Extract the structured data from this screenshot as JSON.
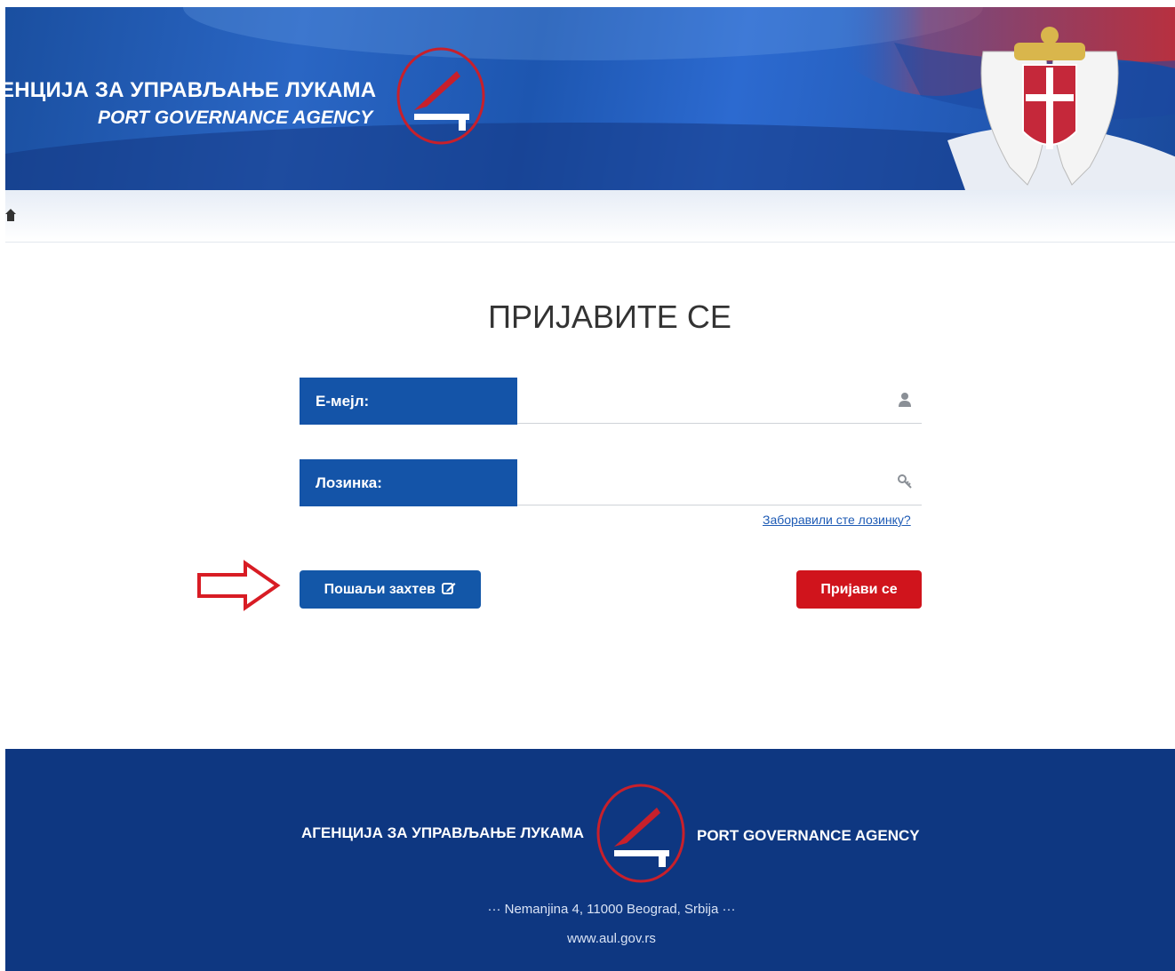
{
  "header": {
    "agency_name_sr": "ЕНЦИЈА ЗА УПРАВЉАЊЕ ЛУКАМА",
    "agency_name_en": "PORT GOVERNANCE AGENCY"
  },
  "navbar": {
    "home_icon": "home-icon"
  },
  "login": {
    "title": "ПРИЈАВИТЕ СЕ",
    "email_label": "Е-мејл:",
    "email_value": "",
    "email_icon": "user-icon",
    "password_label": "Лозинка:",
    "password_value": "",
    "password_icon": "key-icon",
    "forgot_link": "Заборавили сте лозинку?",
    "request_button": "Пошаљи захтев",
    "request_icon": "edit-icon",
    "login_button": "Пријави се"
  },
  "footer": {
    "agency_name_sr": "АГЕНЦИЈА ЗА УПРАВЉАЊЕ ЛУКАМА",
    "agency_name_en": "PORT GOVERNANCE AGENCY",
    "address": "··· Nemanjina 4, 11000 Beograd, Srbija ···",
    "website": "www.aul.gov.rs"
  },
  "colors": {
    "brand_blue": "#1454a8",
    "footer_blue": "#0e3781",
    "login_red": "#d0141c",
    "logo_red": "#c8202b"
  }
}
